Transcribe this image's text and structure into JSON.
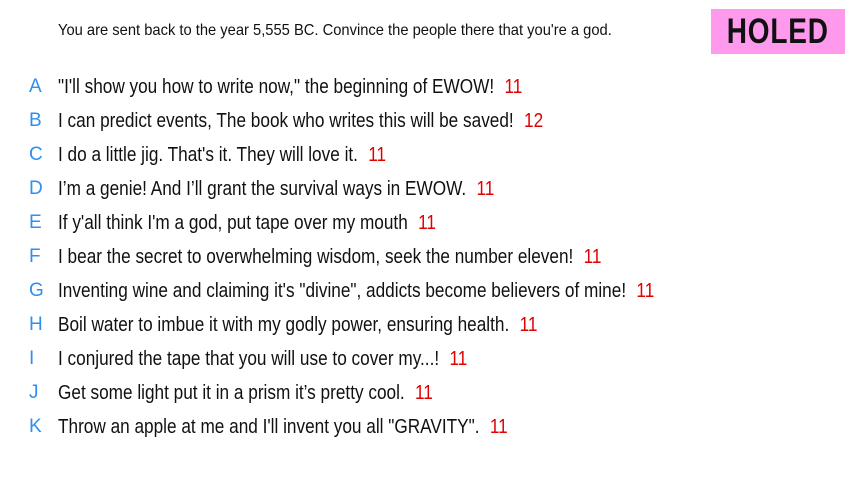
{
  "prompt": "You are sent back to the year 5,555 BC. Convince the people there that you're a god.",
  "status": "HOLED",
  "colors": {
    "letter": "#2f8ff0",
    "score": "#e00000",
    "badge": "#ff99ee"
  },
  "entries": [
    {
      "letter": "A",
      "text": "\"I'll show you how to write now,\" the beginning of EWOW!",
      "score": "11"
    },
    {
      "letter": "B",
      "text": "I can predict events, The book who writes this will be saved!",
      "score": "12"
    },
    {
      "letter": "C",
      "text": "I do a little jig. That's it. They will love it.",
      "score": "11"
    },
    {
      "letter": "D",
      "text": "I’m a genie! And I’ll grant the survival ways in EWOW.",
      "score": "11"
    },
    {
      "letter": "E",
      "text": "If y'all think I'm a god, put tape over my mouth",
      "score": "11"
    },
    {
      "letter": "F",
      "text": "I bear the secret to overwhelming wisdom, seek the number eleven!",
      "score": "11"
    },
    {
      "letter": "G",
      "text": "Inventing wine and claiming it's \"divine\", addicts become believers of mine!",
      "score": "11"
    },
    {
      "letter": "H",
      "text": "Boil water to imbue it with my godly power, ensuring health.",
      "score": "11"
    },
    {
      "letter": "I",
      "text": "I conjured the tape that you will use to cover my...!",
      "score": "11"
    },
    {
      "letter": "J",
      "text": "Get some light put it in a prism it’s pretty cool.",
      "score": "11"
    },
    {
      "letter": "K",
      "text": "Throw an apple at me and I'll invent you all \"GRAVITY\".",
      "score": "11"
    }
  ]
}
